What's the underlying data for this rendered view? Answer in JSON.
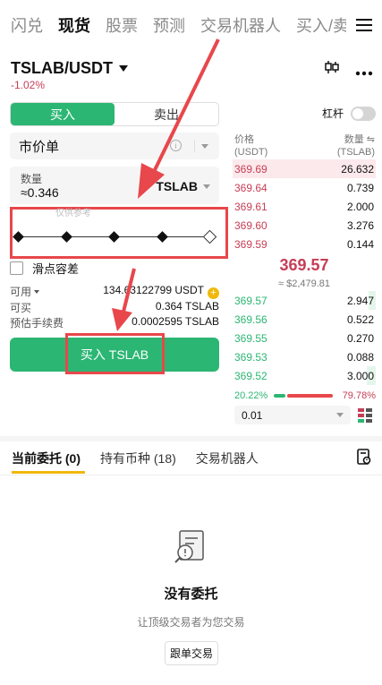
{
  "topnav": {
    "tabs": [
      {
        "label": "闪兑",
        "active": false
      },
      {
        "label": "现货",
        "active": true
      },
      {
        "label": "股票",
        "active": false
      },
      {
        "label": "预测",
        "active": false
      },
      {
        "label": "交易机器人",
        "active": false
      },
      {
        "label": "买入/卖出",
        "active": false
      }
    ],
    "menu_icon": "hamburger-icon"
  },
  "pair": {
    "name": "TSLAB/USDT",
    "change": "-1.02%"
  },
  "order_form": {
    "side_buy": "买入",
    "side_sell": "卖出",
    "order_type": "市价单",
    "info_glyph": "i",
    "qty_label": "数量",
    "qty_value": "≈0.346",
    "qty_unit": "TSLAB",
    "slider_hint": "仅供参考",
    "slider_percent": 100,
    "slippage_label": "滑点容差",
    "available_label": "可用",
    "available_value": "134.63122799 USDT",
    "can_buy_label": "可买",
    "can_buy_value": "0.364 TSLAB",
    "fee_label": "预估手续费",
    "fee_value": "0.0002595 TSLAB",
    "buy_button": "买入 TSLAB"
  },
  "leverage": {
    "label": "杠杆",
    "enabled": false
  },
  "orderbook": {
    "price_header": "价格",
    "price_unit": "(USDT)",
    "qty_header": "数量 ⇋",
    "qty_unit": "(TSLAB)",
    "asks": [
      {
        "price": "369.69",
        "qty": "26.632",
        "depth": 1.0
      },
      {
        "price": "369.64",
        "qty": "0.739",
        "depth": 0.0
      },
      {
        "price": "369.61",
        "qty": "2.000",
        "depth": 0.0
      },
      {
        "price": "369.60",
        "qty": "3.276",
        "depth": 0.0
      },
      {
        "price": "369.59",
        "qty": "0.144",
        "depth": 0.0
      }
    ],
    "mid_price": "369.57",
    "mid_fiat": "≈ $2,479.81",
    "bids": [
      {
        "price": "369.57",
        "qty": "2.947",
        "depth": 0.05
      },
      {
        "price": "369.56",
        "qty": "0.522",
        "depth": 0.0
      },
      {
        "price": "369.55",
        "qty": "0.270",
        "depth": 0.0
      },
      {
        "price": "369.53",
        "qty": "0.088",
        "depth": 0.0
      },
      {
        "price": "369.52",
        "qty": "3.000",
        "depth": 0.06
      }
    ],
    "buy_ratio": "20.22%",
    "sell_ratio": "79.78%",
    "buy_ratio_value": 20.22,
    "precision": "0.01"
  },
  "bottom_tabs": [
    {
      "label": "当前委托 (0)",
      "active": true
    },
    {
      "label": "持有币种 (18)",
      "active": false
    },
    {
      "label": "交易机器人",
      "active": false
    }
  ],
  "empty_state": {
    "title": "没有委托",
    "subtitle": "让顶级交易者为您交易",
    "button": "跟单交易"
  },
  "colors": {
    "buy": "#2bb673",
    "sell": "#c73d55",
    "annotation": "#e8474b",
    "accent": "#f0b90b"
  }
}
